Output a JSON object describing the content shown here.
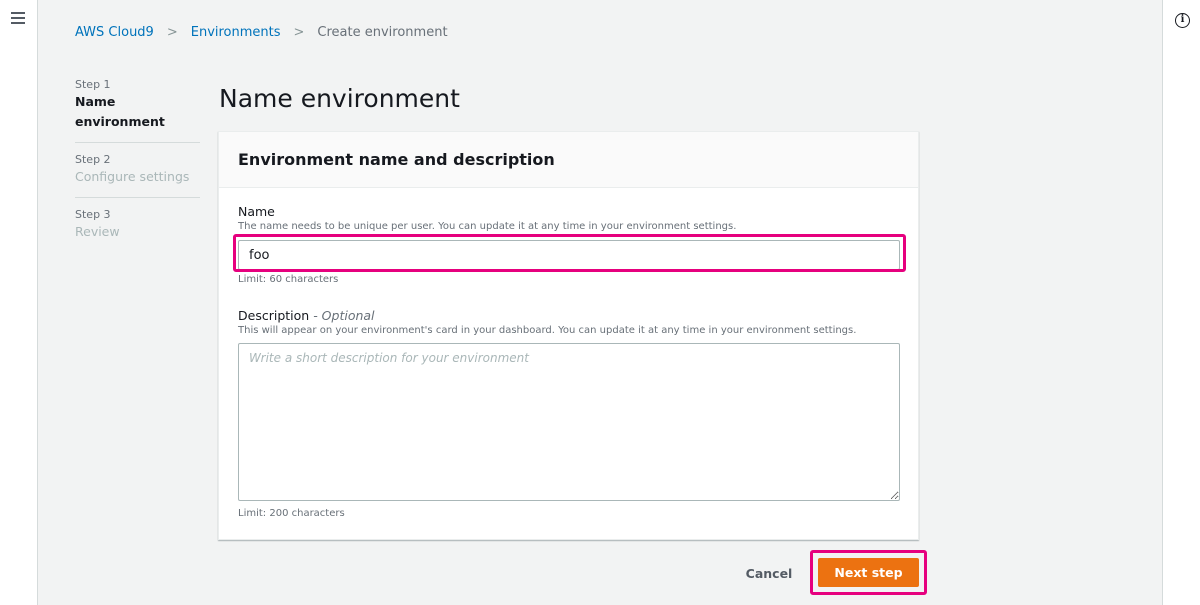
{
  "nav": {
    "menu_icon": "hamburger-icon",
    "info_icon": "info-icon"
  },
  "breadcrumb": {
    "items": [
      "AWS Cloud9",
      "Environments",
      "Create environment"
    ],
    "separator": ">"
  },
  "steps": [
    {
      "number": "Step 1",
      "name": "Name environment",
      "active": true
    },
    {
      "number": "Step 2",
      "name": "Configure settings",
      "active": false
    },
    {
      "number": "Step 3",
      "name": "Review",
      "active": false
    }
  ],
  "page": {
    "title": "Name environment"
  },
  "card": {
    "title": "Environment name and description",
    "name_field": {
      "label": "Name",
      "description": "The name needs to be unique per user. You can update it at any time in your environment settings.",
      "value": "foo",
      "constraint": "Limit: 60 characters"
    },
    "description_field": {
      "label": "Description",
      "optional_text": "- Optional",
      "description": "This will appear on your environment's card in your dashboard. You can update it at any time in your environment settings.",
      "placeholder": "Write a short description for your environment",
      "constraint": "Limit: 200 characters"
    }
  },
  "actions": {
    "cancel_label": "Cancel",
    "next_label": "Next step"
  },
  "colors": {
    "accent": "#ec7211",
    "link": "#0073bb",
    "highlight": "#e6007e"
  }
}
